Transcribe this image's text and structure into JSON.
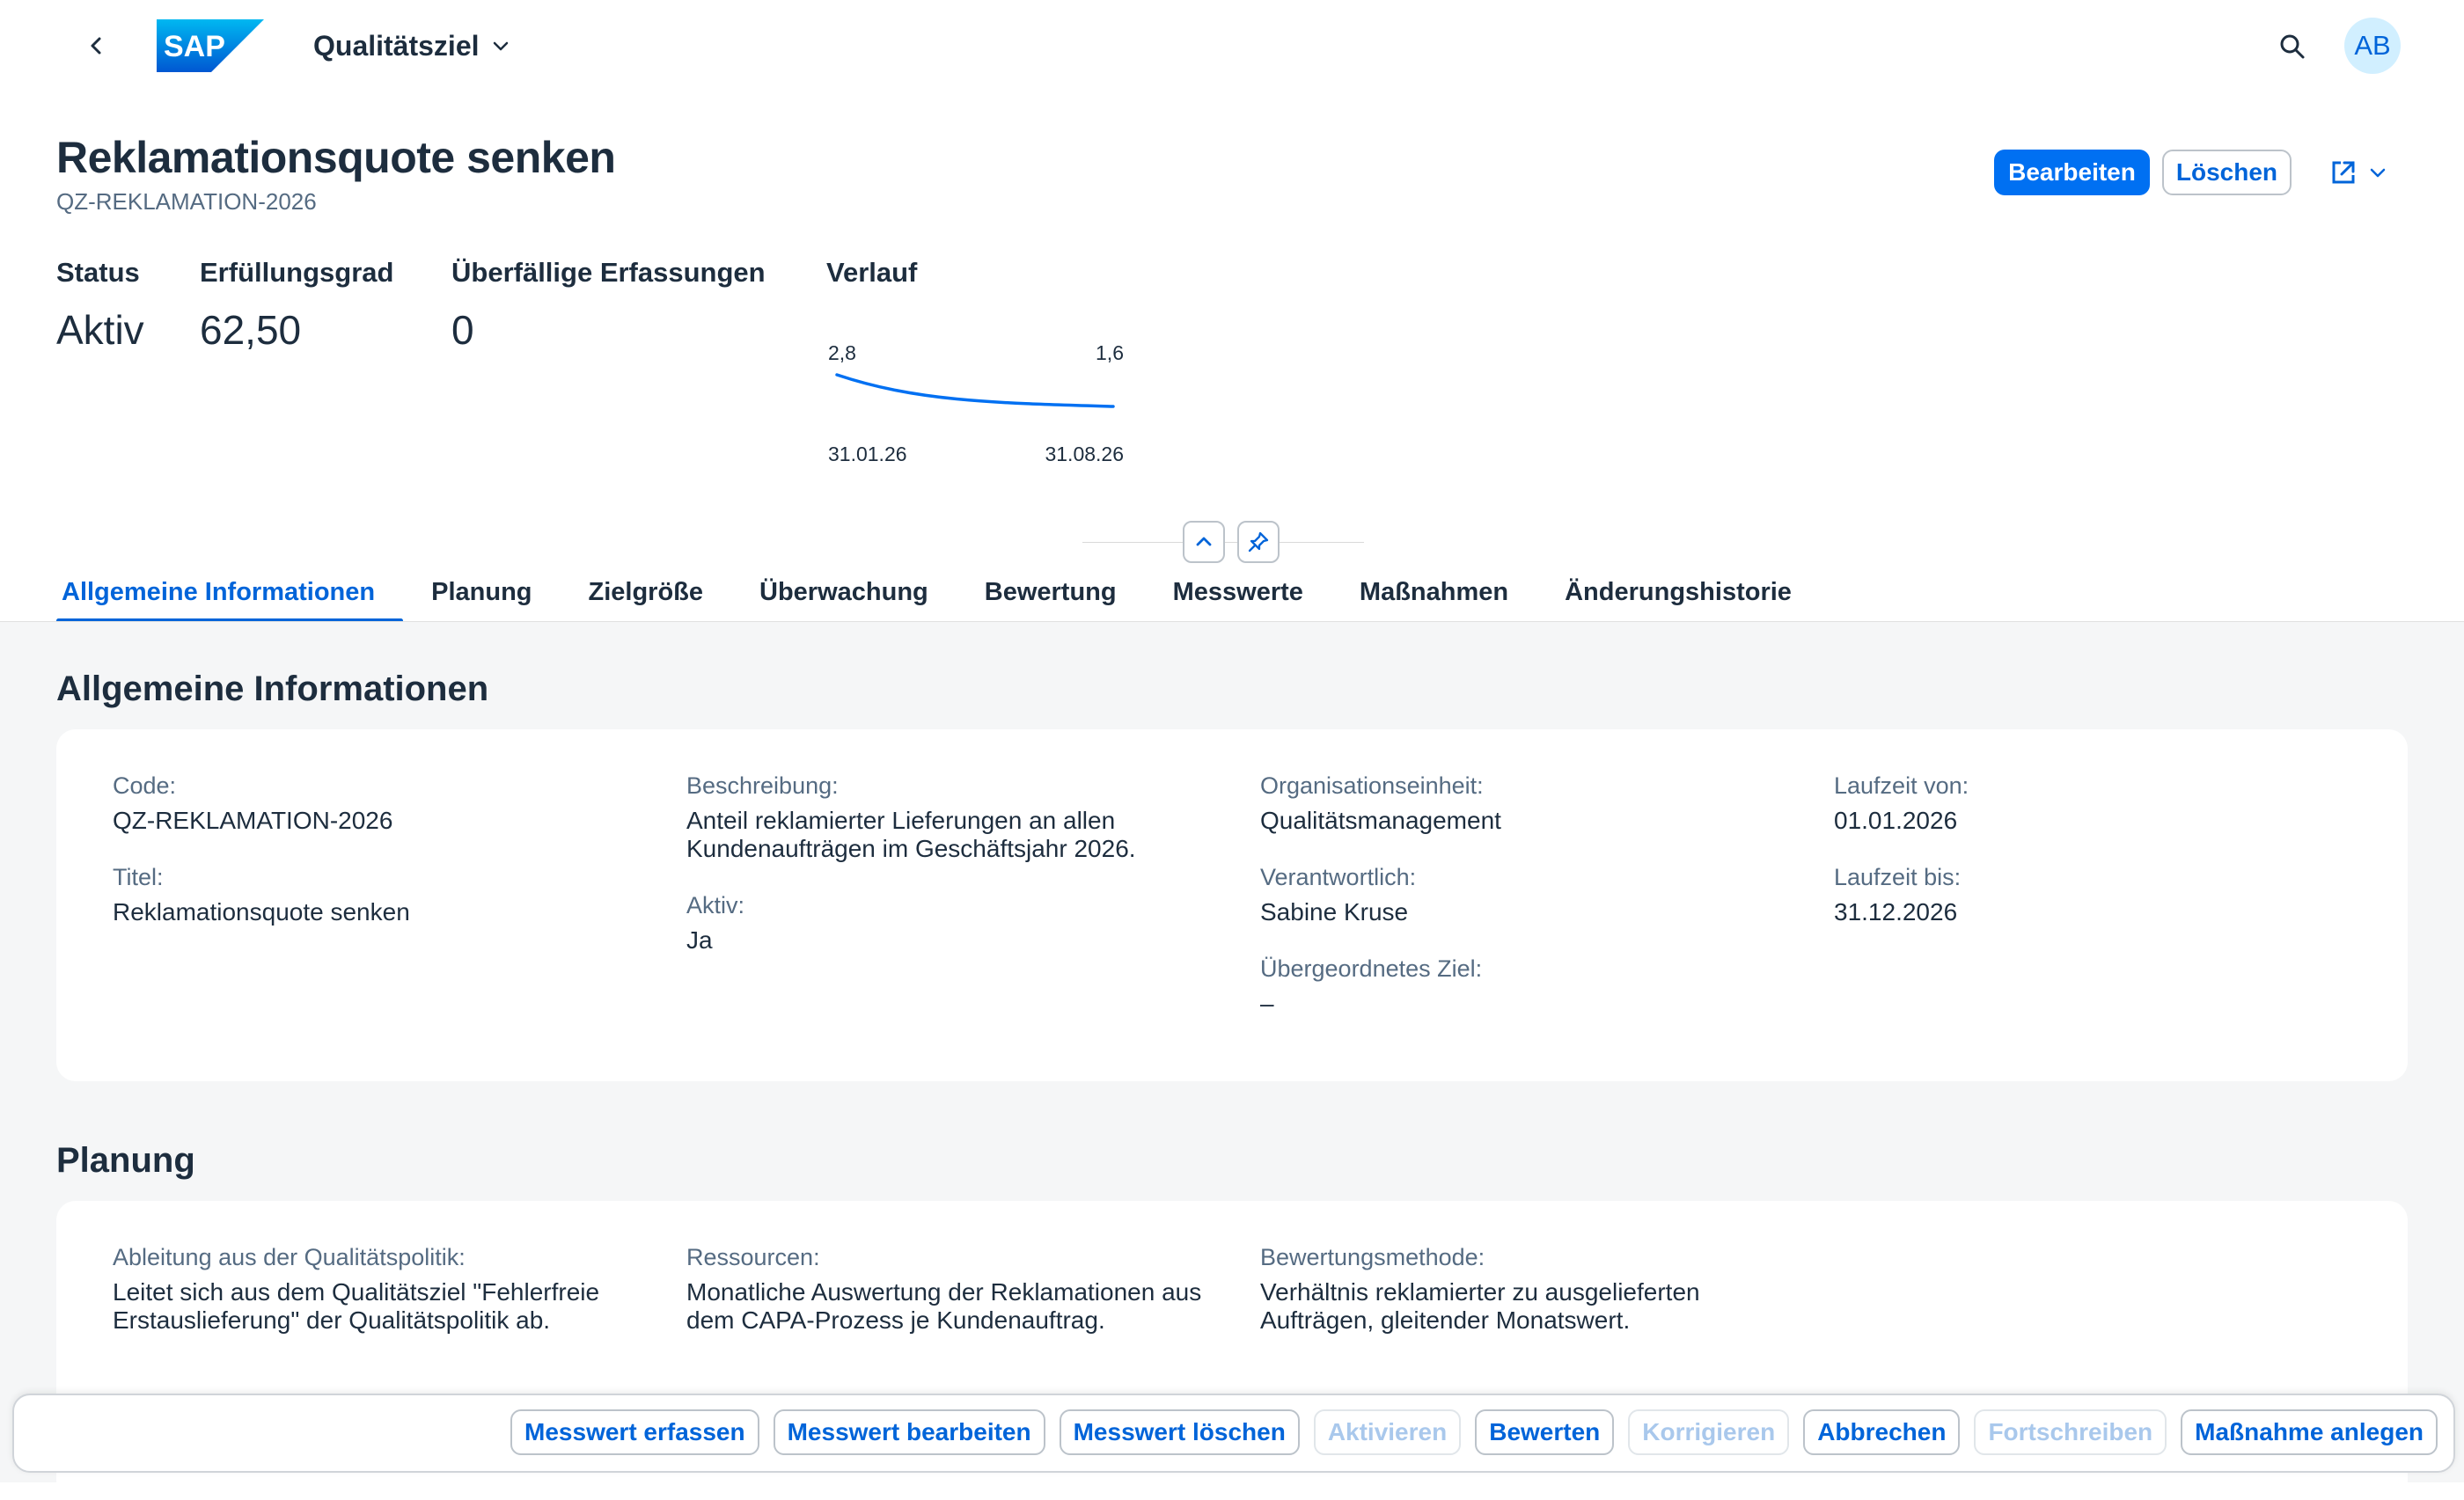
{
  "shell": {
    "logo_text": "SAP",
    "app_title": "Qualitätsziel",
    "avatar_initials": "AB"
  },
  "header": {
    "title": "Reklamationsquote senken",
    "subtitle": "QZ-REKLAMATION-2026",
    "actions": {
      "edit": "Bearbeiten",
      "delete": "Löschen"
    },
    "kpis": {
      "status_label": "Status",
      "status_value": "Aktiv",
      "fulfillment_label": "Erfüllungsgrad",
      "fulfillment_value": "62,50",
      "overdue_label": "Überfällige Erfassungen",
      "overdue_value": "0",
      "trend_label": "Verlauf"
    },
    "trend": {
      "start_value": "2,8",
      "end_value": "1,6",
      "start_date": "31.01.26",
      "end_date": "31.08.26",
      "line_color": "#0070f2"
    }
  },
  "chart_data": {
    "type": "line",
    "x": [
      "31.01.26",
      "31.08.26"
    ],
    "series": [
      {
        "values": [
          2.8,
          1.6
        ]
      }
    ],
    "labels": {
      "first": "2,8",
      "last": "1,6"
    }
  },
  "tabs": [
    {
      "label": "Allgemeine Informationen",
      "active": true
    },
    {
      "label": "Planung"
    },
    {
      "label": "Zielgröße"
    },
    {
      "label": "Überwachung"
    },
    {
      "label": "Bewertung"
    },
    {
      "label": "Messwerte"
    },
    {
      "label": "Maßnahmen"
    },
    {
      "label": "Änderungshistorie"
    }
  ],
  "general": {
    "title": "Allgemeine Informationen",
    "code_label": "Code:",
    "code_value": "QZ-REKLAMATION-2026",
    "titel_label": "Titel:",
    "titel_value": "Reklamationsquote senken",
    "desc_label": "Beschreibung:",
    "desc_value_1": "Anteil reklamierter Lieferungen an allen",
    "desc_value_2": "Kundenaufträgen im Geschäftsjahr 2026.",
    "active_label": "Aktiv:",
    "active_value": "Ja",
    "org_label": "Organisationseinheit:",
    "org_value": "Qualitätsmanagement",
    "resp_label": "Verantwortlich:",
    "resp_value": "Sabine Kruse",
    "parent_label": "Übergeordnetes Ziel:",
    "parent_value": "–",
    "from_label": "Laufzeit von:",
    "from_value": "01.01.2026",
    "to_label": "Laufzeit bis:",
    "to_value": "31.12.2026"
  },
  "planning": {
    "title": "Planung",
    "derive_label": "Ableitung aus der Qualitätspolitik:",
    "derive_value_1": "Leitet sich aus dem Qualitätsziel \"Fehlerfreie",
    "derive_value_2": "Erstauslieferung\" der Qualitätspolitik ab.",
    "res_label": "Ressourcen:",
    "res_value_1": "Monatliche Auswertung der Reklamationen aus",
    "res_value_2": "dem CAPA-Prozess je Kundenauftrag.",
    "method_label": "Bewertungsmethode:",
    "method_value_1": "Verhältnis reklamierter zu ausgelieferten",
    "method_value_2": "Aufträgen, gleitender Monatswert."
  },
  "footer": {
    "buttons": [
      {
        "label": "Messwert erfassen",
        "enabled": true
      },
      {
        "label": "Messwert bearbeiten",
        "enabled": true
      },
      {
        "label": "Messwert löschen",
        "enabled": true
      },
      {
        "label": "Aktivieren",
        "enabled": false
      },
      {
        "label": "Bewerten",
        "enabled": true
      },
      {
        "label": "Korrigieren",
        "enabled": false
      },
      {
        "label": "Abbrechen",
        "enabled": true
      },
      {
        "label": "Fortschreiben",
        "enabled": false
      },
      {
        "label": "Maßnahme anlegen",
        "enabled": true
      }
    ]
  }
}
